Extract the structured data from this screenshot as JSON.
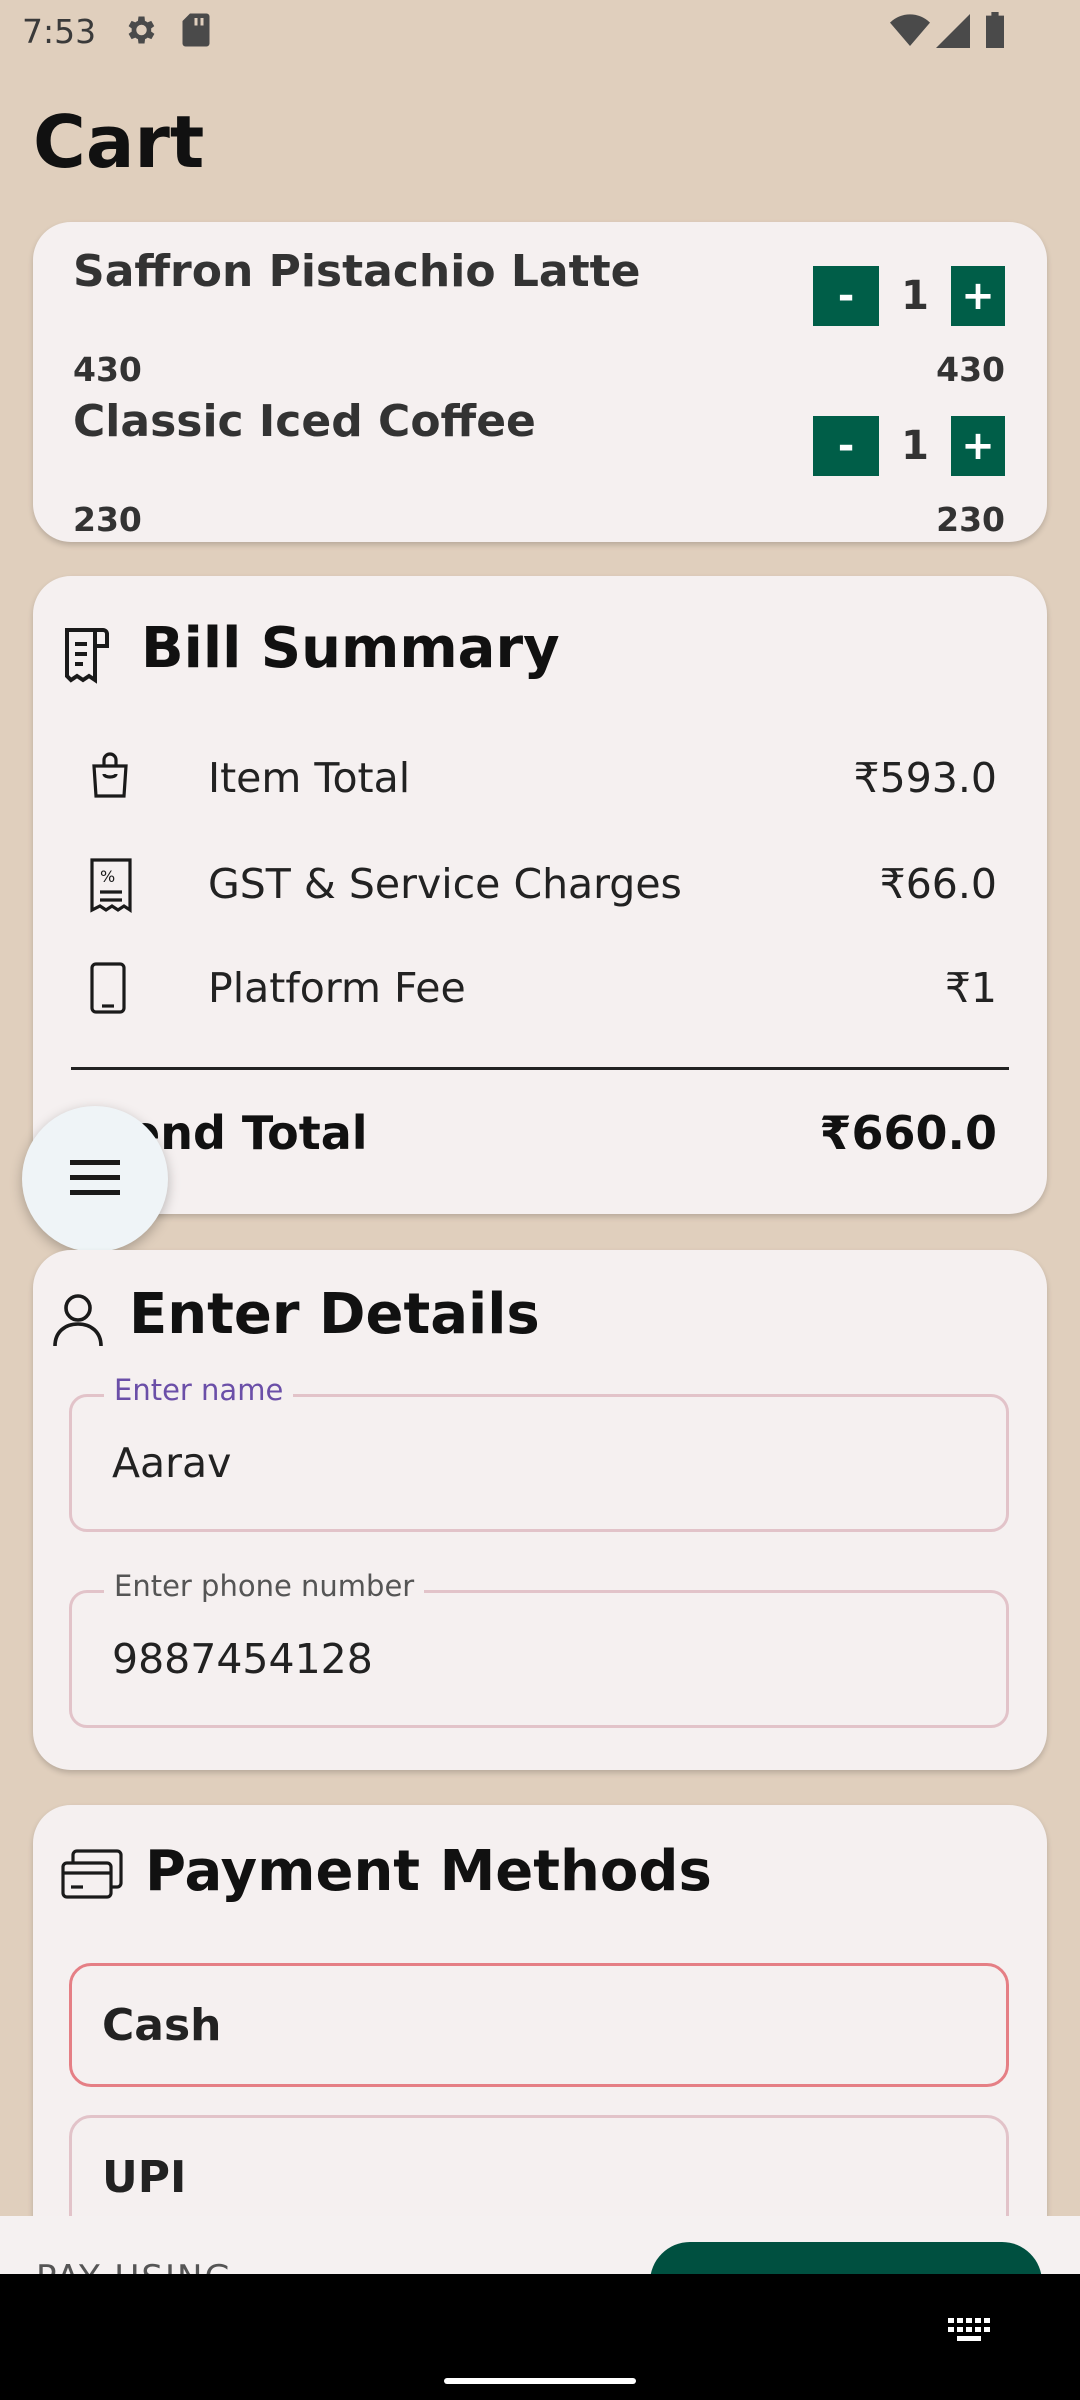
{
  "status_bar": {
    "time": "7:53",
    "left_icons": [
      "gear-icon",
      "sd-card-icon"
    ],
    "right_icons": [
      "wifi-icon",
      "signal-icon",
      "battery-icon"
    ]
  },
  "page_title": "Cart",
  "cart": {
    "items": [
      {
        "name": "Saffron Pistachio Latte",
        "price": "430",
        "quantity": "1",
        "line_total": "430",
        "minus_label": "-",
        "plus_label": "+"
      },
      {
        "name": "Classic Iced Coffee",
        "price": "230",
        "quantity": "1",
        "line_total": "230",
        "minus_label": "-",
        "plus_label": "+"
      }
    ]
  },
  "bill_summary": {
    "heading": "Bill Summary",
    "rows": [
      {
        "icon": "shopping-bag-icon",
        "label": "Item Total",
        "value": "₹593.0"
      },
      {
        "icon": "tax-receipt-icon",
        "label": "GST & Service Charges",
        "value": "₹66.0"
      },
      {
        "icon": "phone-icon",
        "label": "Platform Fee",
        "value": "₹1"
      }
    ],
    "grand_total_label": "end Total",
    "grand_total_value": "₹660.0"
  },
  "details": {
    "heading": "Enter Details",
    "name_label": "Enter name",
    "name_value": "Aarav",
    "phone_label": "Enter phone number",
    "phone_value": "9887454128"
  },
  "payment": {
    "heading": "Payment Methods",
    "options": [
      {
        "label": "Cash",
        "selected": true
      },
      {
        "label": "UPI",
        "selected": false
      }
    ]
  },
  "bottom_bar": {
    "pay_using_label": "PAY USING"
  },
  "colors": {
    "background": "#e0cfbd",
    "card": "#f5f0f0",
    "accent_green": "#005e48",
    "selected_border": "#e57f85",
    "focused_label": "#6b4fa8"
  }
}
